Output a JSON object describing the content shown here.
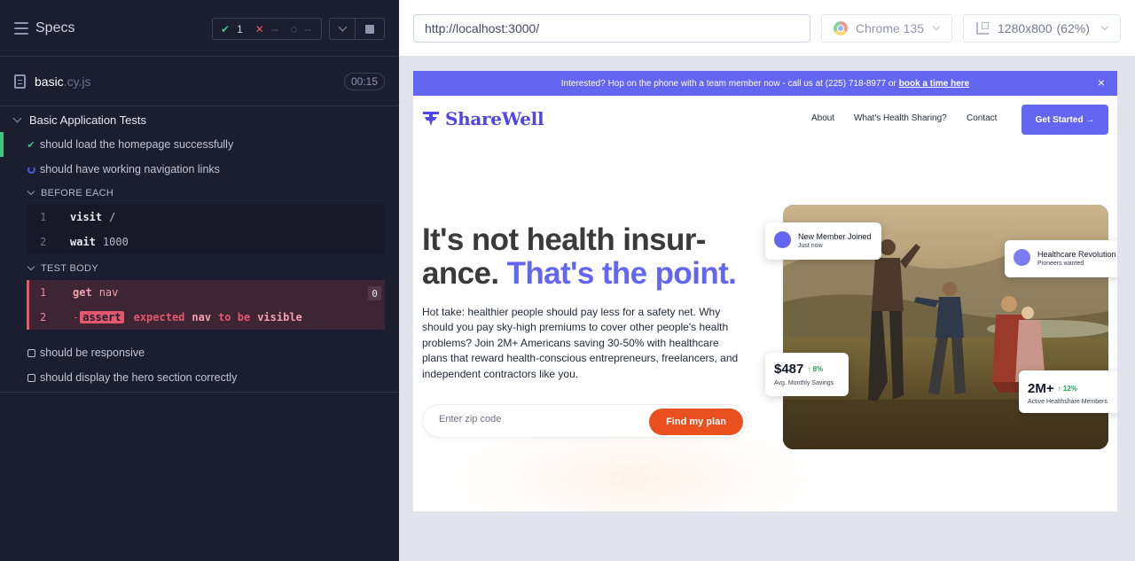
{
  "reporter": {
    "header": {
      "title": "Specs",
      "passed": "1",
      "failed": "--",
      "pending": "--"
    },
    "file": {
      "name": "basic",
      "ext": ".cy.js",
      "duration": "00:15"
    },
    "suite": {
      "title": "Basic Application Tests",
      "tests": [
        {
          "title": "should load the homepage successfully",
          "state": "passed"
        },
        {
          "title": "should have working navigation links",
          "state": "running"
        },
        {
          "title": "should be responsive",
          "state": "pending"
        },
        {
          "title": "should display the hero section correctly",
          "state": "pending"
        }
      ],
      "before_each": {
        "label": "BEFORE EACH",
        "commands": [
          {
            "num": "1",
            "name": "visit",
            "arg": "/"
          },
          {
            "num": "2",
            "name": "wait",
            "arg": "1000"
          }
        ]
      },
      "test_body": {
        "label": "TEST BODY",
        "commands": [
          {
            "num": "1",
            "name": "get",
            "arg": "nav",
            "badge": "0"
          },
          {
            "num": "2",
            "dash": "-",
            "name": "assert",
            "parts": [
              "expected",
              "nav",
              "to be",
              "visible"
            ]
          }
        ]
      }
    }
  },
  "browser": {
    "url": "http://localhost:3000/",
    "browser_name": "Chrome 135",
    "viewport": "1280x800",
    "zoom": "(62%)"
  },
  "site": {
    "announce": {
      "text": "Interested? Hop on the phone with a team member now - call us at (225) 718-8977 or",
      "link": "book a time here",
      "close": "×"
    },
    "logo": "ShareWell",
    "nav": [
      "About",
      "What's Health Sharing?",
      "Contact"
    ],
    "cta": "Get Started →",
    "hero": {
      "title_line1": "It's not health insur-",
      "title_line2a": "ance. ",
      "title_line2b": "That's the point.",
      "body": "Hot take: healthier people should pay less for a safety net. Why should you pay sky-high premiums to cover other people's health problems? Join 2M+ Americans saving 30-50% with healthcare plans that reward health-conscious entrepreneurs, freelancers, and independent contractors like you.",
      "zip_placeholder": "Enter zip code",
      "zip_button": "Find my plan"
    },
    "cards": {
      "new_member": {
        "title": "New Member Joined",
        "sub": "Just now"
      },
      "revolution": {
        "title": "Healthcare Revolution",
        "sub": "Pioneers wanted"
      },
      "savings": {
        "value": "$487",
        "change": "↑ 8%",
        "label": "Avg. Monthly Savings"
      },
      "members": {
        "value": "2M+",
        "change": "↑ 12%",
        "label": "Active Healthshare Members"
      }
    }
  },
  "colors": {
    "reporter_bg": "#1b1e2e",
    "pass": "#3fc686",
    "fail": "#e45770",
    "brand": "#6366f1",
    "cta_orange": "#ea4f1f"
  }
}
